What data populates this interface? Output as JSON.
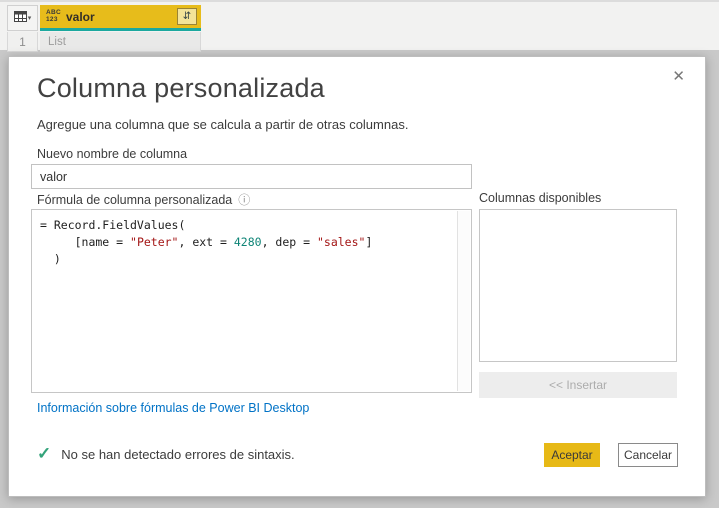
{
  "grid": {
    "column": {
      "type_label_top": "ABC",
      "type_label_bottom": "123",
      "name": "valor"
    },
    "row_number": "1",
    "cell_value": "List"
  },
  "dialog": {
    "title": "Columna personalizada",
    "subtitle": "Agregue una columna que se calcula a partir de otras columnas.",
    "new_name_label": "Nuevo nombre de columna",
    "new_name_value": "valor",
    "formula_label": "Fórmula de columna personalizada",
    "formula_segments": [
      {
        "type": "plain",
        "text": "= Record.FieldValues(\n"
      },
      {
        "type": "plain",
        "text": "     [name = "
      },
      {
        "type": "string",
        "text": "\"Peter\""
      },
      {
        "type": "plain",
        "text": ", ext = "
      },
      {
        "type": "number",
        "text": "4280"
      },
      {
        "type": "plain",
        "text": ", dep = "
      },
      {
        "type": "string",
        "text": "\"sales\""
      },
      {
        "type": "plain",
        "text": "]\n"
      },
      {
        "type": "plain",
        "text": "  )"
      }
    ],
    "formula_link": "Información sobre fórmulas de Power BI Desktop",
    "available_columns_label": "Columnas disponibles",
    "insert_button_label": "<< Insertar",
    "status_message": "No se han detectado errores de sintaxis.",
    "ok_button_label": "Aceptar",
    "cancel_button_label": "Cancelar"
  },
  "icons": {
    "close": "✕",
    "info": "ⓘ",
    "check": "✓",
    "expand_arrows": "⇵",
    "dropdown_caret": "▾"
  },
  "colors": {
    "header_yellow": "#e7bc1b",
    "quality_bar_teal": "#1ca89e",
    "accent_button_yellow": "#e7b916",
    "link_blue": "#0072c6",
    "code_string_red": "#a31515",
    "code_number_green": "#0e8476",
    "success_green": "#33a37a"
  }
}
